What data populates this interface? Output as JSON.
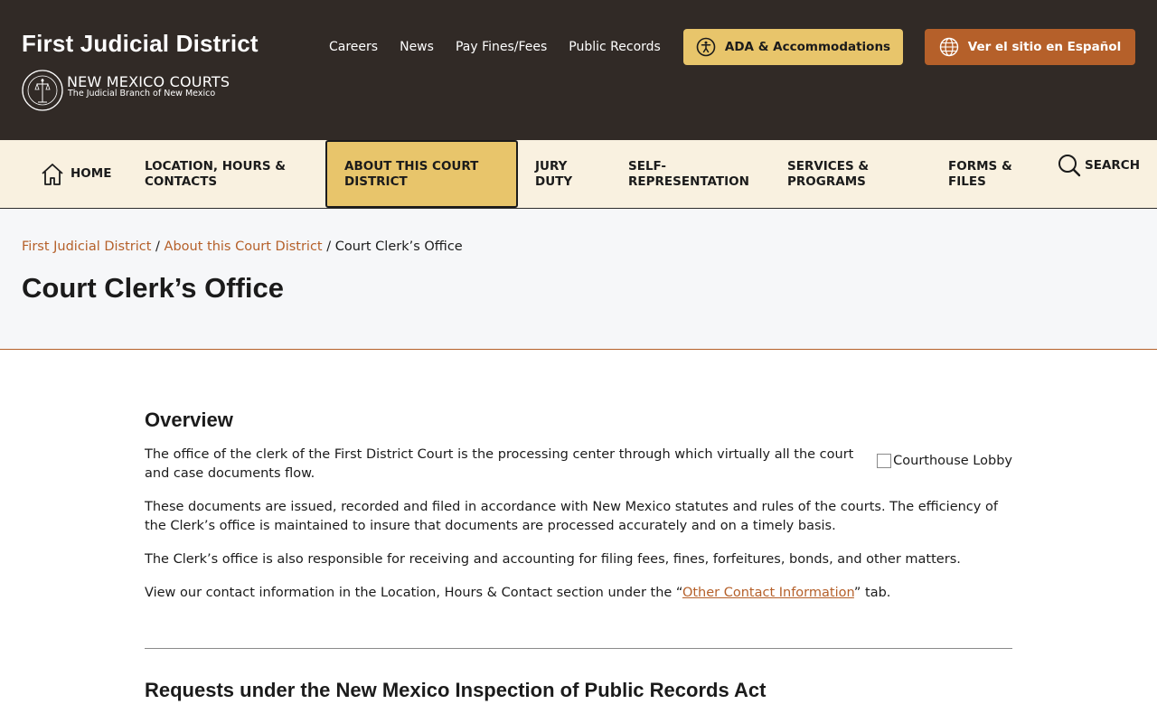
{
  "header": {
    "site_title": "First Judicial District",
    "courts_name": "NEW MEXICO COURTS",
    "courts_subtitle": "The Judicial Branch of New Mexico",
    "links": [
      "Careers",
      "News",
      "Pay Fines/Fees",
      "Public Records"
    ],
    "ada_label": "ADA & Accommodations",
    "spanish_label": "Ver el sitio en Español"
  },
  "nav": {
    "home": "HOME",
    "location_l1": "LOCATION, HOURS &",
    "location_l2": "CONTACTS",
    "about_l1": "ABOUT THIS COURT",
    "about_l2": "DISTRICT",
    "jury_l1": "JURY",
    "jury_l2": "DUTY",
    "self_l1": "SELF-",
    "self_l2": "REPRESENTATION",
    "services_l1": "SERVICES &",
    "services_l2": "PROGRAMS",
    "forms_l1": "FORMS &",
    "forms_l2": "FILES",
    "search": "SEARCH"
  },
  "breadcrumb": {
    "crumb1": "First Judicial District",
    "sep": " / ",
    "crumb2": "About this Court District",
    "current": "Court Clerk’s Office"
  },
  "page_title": "Court Clerk’s Office",
  "overview": {
    "heading": "Overview",
    "p1": "The office of the clerk of the First District Court is the processing center through which virtually all the court and case documents flow.",
    "p2": "These documents are issued, recorded and filed in accordance with New Mexico statutes and rules of the courts. The efficiency of the Clerk’s office is maintained to insure that documents are processed accurately and on a timely basis.",
    "p3": "The Clerk’s office is also responsible for receiving and accounting for filing fees, fines, forfeitures, bonds, and other matters.",
    "p4_before": "View our contact information in the Location, Hours & Contact section under the “",
    "p4_link": "Other Contact Information",
    "p4_after": "” tab.",
    "image_alt": "Courthouse Lobby"
  },
  "records": {
    "heading": "Requests under the New Mexico Inspection of Public Records Act"
  },
  "colors": {
    "header_bg": "#312a26",
    "accent_gold": "#e8c56b",
    "accent_rust": "#b5602a",
    "nav_bg": "#f9f1e0"
  }
}
